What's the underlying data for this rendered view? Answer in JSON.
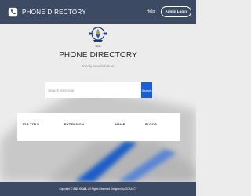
{
  "navbar": {
    "title": "PHONE DIRECTORY",
    "help_label": "Help!",
    "login_label": "Admin Login"
  },
  "hero": {
    "emblem_caption": "GCAA",
    "title": "PHONE DIRECTORY",
    "subtitle": "Kindly search below"
  },
  "search": {
    "placeholder": "Search extension",
    "button_label": "Search"
  },
  "table": {
    "columns": [
      "JOB TITLE",
      "EXTENSION",
      "NAME",
      "FLOOR"
    ]
  },
  "footer": {
    "text_prefix": "Copyright © ",
    "text_bold": "2022 GCAA.",
    "text_suffix": " All Rights Reserved Designed by GCAA ICT"
  },
  "colors": {
    "navbar": "#3c4b63",
    "accent": "#1b5fd6",
    "background": "#ececec"
  }
}
